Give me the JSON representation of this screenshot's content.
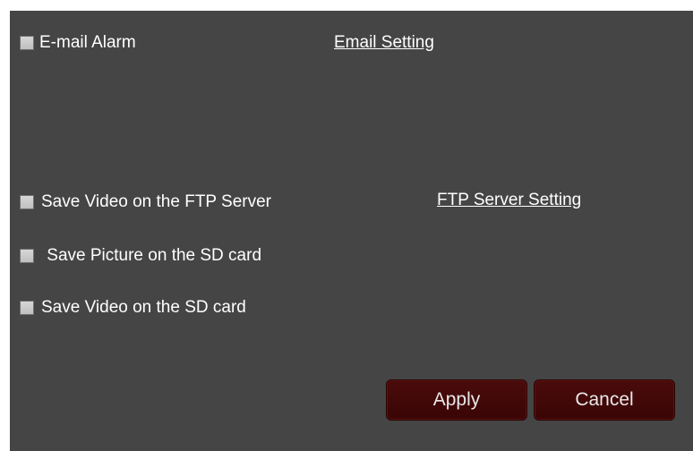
{
  "alarm": {
    "email": {
      "label": "E-mail Alarm",
      "checked": false,
      "setting_link": "Email Setting"
    }
  },
  "recording": {
    "ftp_video": {
      "label": "Save Video on the FTP Server",
      "checked": false,
      "setting_link": "FTP Server Setting"
    },
    "sd_picture": {
      "label": " Save Picture on the SD card",
      "checked": false
    },
    "sd_video": {
      "label": "Save Video on the SD card",
      "checked": false
    }
  },
  "buttons": {
    "apply": "Apply",
    "cancel": "Cancel"
  },
  "colors": {
    "panel_bg": "#454545",
    "button_bg": "#3e0707",
    "text": "#ffffff"
  }
}
